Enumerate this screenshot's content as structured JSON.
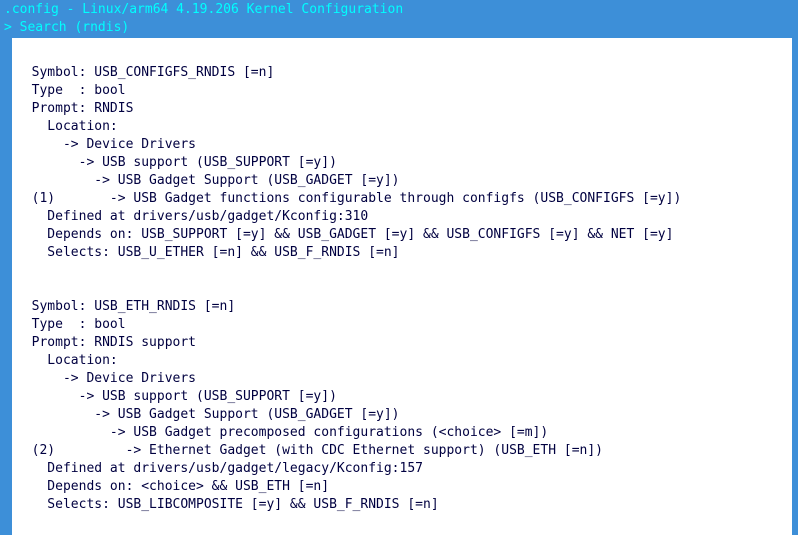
{
  "title": ".config - Linux/arm64 4.19.206 Kernel Configuration",
  "search_prefix": "> ",
  "search_label": "Search (rndis)",
  "lines": [
    "",
    "  Symbol: USB_CONFIGFS_RNDIS [=n]",
    "  Type  : bool",
    "  Prompt: RNDIS",
    "    Location:",
    "      -> Device Drivers",
    "        -> USB support (USB_SUPPORT [=y])",
    "          -> USB Gadget Support (USB_GADGET [=y])",
    "  (1)       -> USB Gadget functions configurable through configfs (USB_CONFIGFS [=y])",
    "    Defined at drivers/usb/gadget/Kconfig:310",
    "    Depends on: USB_SUPPORT [=y] && USB_GADGET [=y] && USB_CONFIGFS [=y] && NET [=y]",
    "    Selects: USB_U_ETHER [=n] && USB_F_RNDIS [=n]",
    "",
    "",
    "  Symbol: USB_ETH_RNDIS [=n]",
    "  Type  : bool",
    "  Prompt: RNDIS support",
    "    Location:",
    "      -> Device Drivers",
    "        -> USB support (USB_SUPPORT [=y])",
    "          -> USB Gadget Support (USB_GADGET [=y])",
    "            -> USB Gadget precomposed configurations (<choice> [=m])",
    "  (2)         -> Ethernet Gadget (with CDC Ethernet support) (USB_ETH [=n])",
    "    Defined at drivers/usb/gadget/legacy/Kconfig:157",
    "    Depends on: <choice> && USB_ETH [=n]",
    "    Selects: USB_LIBCOMPOSITE [=y] && USB_F_RNDIS [=n]",
    ""
  ]
}
